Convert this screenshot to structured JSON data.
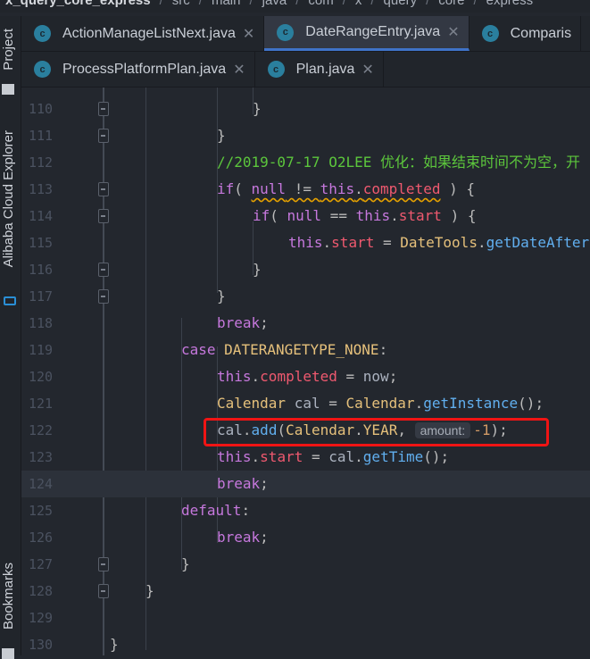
{
  "breadcrumb": [
    "x_query_core_express",
    "src",
    "main",
    "java",
    "com",
    "x",
    "query",
    "core",
    "express"
  ],
  "sidebar": {
    "project": "Project",
    "cloud": "Alibaba Cloud Explorer",
    "bookmarks": "Bookmarks"
  },
  "tabs_row1": [
    {
      "label": "ActionManageListNext.java",
      "active": false
    },
    {
      "label": "DateRangeEntry.java",
      "active": true
    },
    {
      "label": "Comparis",
      "active": false
    }
  ],
  "tabs_row2": [
    {
      "label": "ProcessPlatformPlan.java"
    },
    {
      "label": "Plan.java"
    }
  ],
  "current_line": 124,
  "highlighted_line": 122,
  "lines": [
    {
      "n": "110",
      "i": 4,
      "fold": true,
      "t": [
        [
          "p",
          "}"
        ]
      ]
    },
    {
      "n": "111",
      "i": 3,
      "fold": true,
      "t": [
        [
          "p",
          "}"
        ]
      ]
    },
    {
      "n": "112",
      "i": 3,
      "t": [
        [
          "cm",
          "//2019-07-17 O2LEE 优化：如果结束时间不为空，开"
        ]
      ]
    },
    {
      "n": "113",
      "i": 3,
      "fold": true,
      "t": [
        [
          "k",
          "if"
        ],
        [
          "p",
          "( "
        ],
        [
          "kw",
          "null"
        ],
        [
          "pw",
          " != "
        ],
        [
          "kw",
          "this"
        ],
        [
          "pw",
          "."
        ],
        [
          "fw",
          "completed"
        ],
        [
          "p",
          " ) {"
        ]
      ]
    },
    {
      "n": "114",
      "i": 4,
      "fold": true,
      "t": [
        [
          "k",
          "if"
        ],
        [
          "p",
          "( "
        ],
        [
          "k",
          "null"
        ],
        [
          "p",
          " == "
        ],
        [
          "k",
          "this"
        ],
        [
          "p",
          "."
        ],
        [
          "f",
          "start"
        ],
        [
          "p",
          " ) {"
        ]
      ]
    },
    {
      "n": "115",
      "i": 5,
      "t": [
        [
          "k",
          "this"
        ],
        [
          "p",
          "."
        ],
        [
          "f",
          "start"
        ],
        [
          "p",
          " = "
        ],
        [
          "c",
          "DateTools"
        ],
        [
          "p",
          "."
        ],
        [
          "m",
          "getDateAfter"
        ]
      ]
    },
    {
      "n": "116",
      "i": 4,
      "fold": true,
      "t": [
        [
          "p",
          "}"
        ]
      ]
    },
    {
      "n": "117",
      "i": 3,
      "fold": true,
      "t": [
        [
          "p",
          "}"
        ]
      ]
    },
    {
      "n": "118",
      "i": 3,
      "t": [
        [
          "k",
          "break"
        ],
        [
          "p",
          ";"
        ]
      ]
    },
    {
      "n": "119",
      "i": 2,
      "t": [
        [
          "k",
          "case "
        ],
        [
          "c",
          "DATERANGETYPE_NONE"
        ],
        [
          "p",
          ":"
        ]
      ]
    },
    {
      "n": "120",
      "i": 3,
      "t": [
        [
          "k",
          "this"
        ],
        [
          "p",
          "."
        ],
        [
          "f",
          "completed"
        ],
        [
          "p",
          " = "
        ],
        [
          "v",
          "now"
        ],
        [
          "p",
          ";"
        ]
      ]
    },
    {
      "n": "121",
      "i": 3,
      "t": [
        [
          "c",
          "Calendar"
        ],
        [
          "v",
          " cal"
        ],
        [
          "p",
          " = "
        ],
        [
          "c",
          "Calendar"
        ],
        [
          "p",
          "."
        ],
        [
          "m",
          "getInstance"
        ],
        [
          "p",
          "();"
        ]
      ]
    },
    {
      "n": "122",
      "i": 3,
      "t": [
        [
          "v",
          "cal"
        ],
        [
          "p",
          "."
        ],
        [
          "m",
          "add"
        ],
        [
          "p",
          "("
        ],
        [
          "c",
          "Calendar"
        ],
        [
          "p",
          "."
        ],
        [
          "c",
          "YEAR"
        ],
        [
          "p",
          ", "
        ],
        [
          "hint",
          "amount:"
        ],
        [
          "n",
          "-1"
        ],
        [
          "p",
          ");"
        ]
      ]
    },
    {
      "n": "123",
      "i": 3,
      "t": [
        [
          "k",
          "this"
        ],
        [
          "p",
          "."
        ],
        [
          "f",
          "start"
        ],
        [
          "p",
          " = "
        ],
        [
          "v",
          "cal"
        ],
        [
          "p",
          "."
        ],
        [
          "m",
          "getTime"
        ],
        [
          "p",
          "();"
        ]
      ]
    },
    {
      "n": "124",
      "i": 3,
      "t": [
        [
          "k",
          "break"
        ],
        [
          "p",
          ";"
        ]
      ]
    },
    {
      "n": "125",
      "i": 2,
      "t": [
        [
          "k",
          "default"
        ],
        [
          "p",
          ":"
        ]
      ]
    },
    {
      "n": "126",
      "i": 3,
      "t": [
        [
          "k",
          "break"
        ],
        [
          "p",
          ";"
        ]
      ]
    },
    {
      "n": "127",
      "i": 2,
      "fold": true,
      "t": [
        [
          "p",
          "}"
        ]
      ]
    },
    {
      "n": "128",
      "i": 1,
      "fold": true,
      "t": [
        [
          "p",
          "}"
        ]
      ]
    },
    {
      "n": "129",
      "i": 0,
      "t": []
    },
    {
      "n": "130",
      "i": 0,
      "t": [
        [
          "p",
          "}"
        ]
      ]
    }
  ]
}
